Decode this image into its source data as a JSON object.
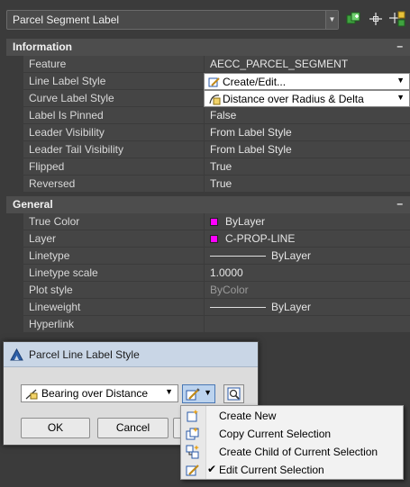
{
  "selector": {
    "label": "Parcel Segment Label"
  },
  "toolbar": {
    "icons": [
      "quick-select-icon",
      "pick-object-icon",
      "toggle-pickadd-icon"
    ]
  },
  "information": {
    "title": "Information",
    "collapse": "–",
    "rows": [
      {
        "name": "Feature",
        "value": "AECC_PARCEL_SEGMENT"
      },
      {
        "name": "Line Label Style",
        "value": "Create/Edit..."
      },
      {
        "name": "Curve Label Style",
        "value": "Distance over Radius & Delta"
      },
      {
        "name": "Label Is Pinned",
        "value": "False"
      },
      {
        "name": "Leader Visibility",
        "value": "From Label Style"
      },
      {
        "name": "Leader Tail Visibility",
        "value": "From Label Style"
      },
      {
        "name": "Flipped",
        "value": "True"
      },
      {
        "name": "Reversed",
        "value": "True"
      }
    ]
  },
  "general": {
    "title": "General",
    "collapse": "–",
    "rows": [
      {
        "name": "True Color",
        "value": "ByLayer"
      },
      {
        "name": "Layer",
        "value": "C-PROP-LINE"
      },
      {
        "name": "Linetype",
        "value": "ByLayer"
      },
      {
        "name": "Linetype scale",
        "value": "1.0000"
      },
      {
        "name": "Plot style",
        "value": "ByColor"
      },
      {
        "name": "Lineweight",
        "value": "ByLayer"
      },
      {
        "name": "Hyperlink",
        "value": ""
      }
    ]
  },
  "dialog": {
    "title": "Parcel Line Label Style",
    "combo_value": "Bearing over Distance",
    "ok_label": "OK",
    "cancel_label": "Cancel"
  },
  "menu": {
    "items": [
      {
        "label": "Create New",
        "checked": false
      },
      {
        "label": "Copy Current Selection",
        "checked": false
      },
      {
        "label": "Create Child of Current Selection",
        "checked": false
      },
      {
        "label": "Edit Current Selection",
        "checked": true
      }
    ],
    "check_glyph": "✔"
  },
  "colors": {
    "layer_color": "#ff00ff",
    "panel_bg": "#3b3b3b",
    "dialog_title_bg": "#c9d6e6"
  }
}
